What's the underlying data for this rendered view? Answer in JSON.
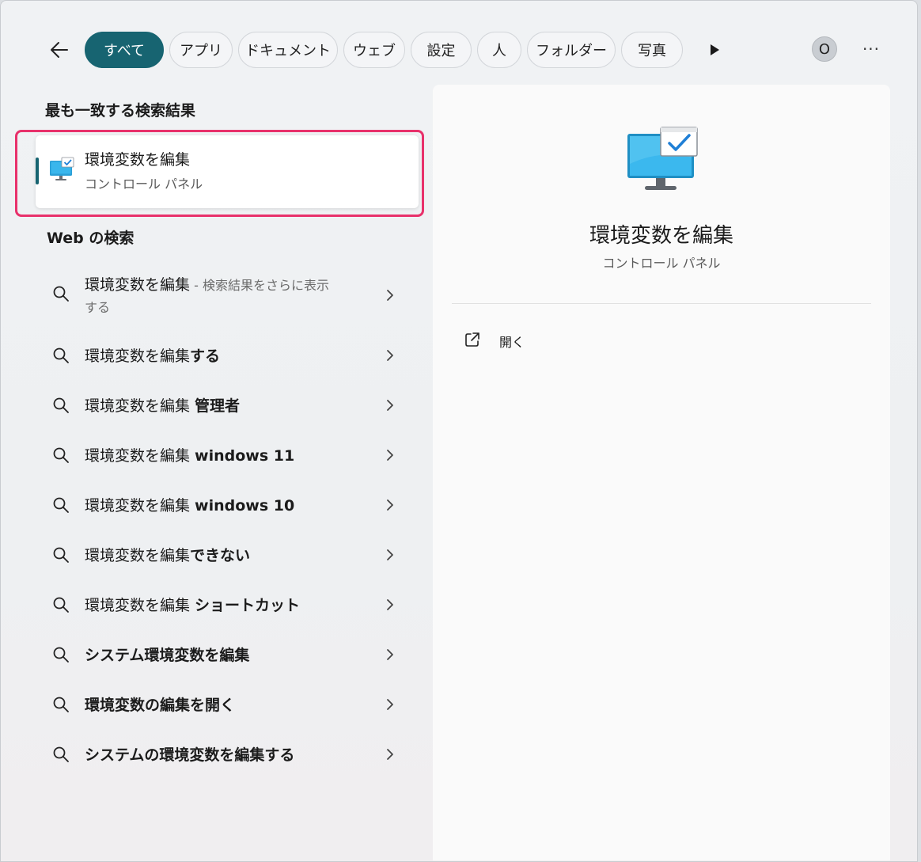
{
  "filters": {
    "back_icon": "arrow-left-icon",
    "tabs": [
      {
        "label": "すべて",
        "active": true
      },
      {
        "label": "アプリ"
      },
      {
        "label": "ドキュメント"
      },
      {
        "label": "ウェブ"
      },
      {
        "label": "設定"
      },
      {
        "label": "人"
      },
      {
        "label": "フォルダー"
      },
      {
        "label": "写真"
      }
    ],
    "more_tabs_icon": "play-icon",
    "avatar_letter": "O",
    "more_label": "···"
  },
  "best_match": {
    "section_title": "最も一致する検索結果",
    "title": "環境変数を編集",
    "subtitle": "コントロール パネル",
    "icon": "monitor-check-icon"
  },
  "web": {
    "section_title": "Web の検索",
    "items": [
      {
        "text": "環境変数を編集",
        "suffix": " - 検索結果をさらに表示",
        "line2": "する"
      },
      {
        "text": "環境変数を編集",
        "bold": "する"
      },
      {
        "text": "環境変数を編集 ",
        "bold": "管理者"
      },
      {
        "text": "環境変数を編集 ",
        "bold": "windows 11"
      },
      {
        "text": "環境変数を編集 ",
        "bold": "windows 10"
      },
      {
        "text": "環境変数を編集",
        "bold": "できない"
      },
      {
        "text": "環境変数を編集 ",
        "bold": "ショートカット"
      },
      {
        "text": "",
        "bold": "システム環境変数を編集"
      },
      {
        "text": "",
        "bold": "環境変数の編集を開く"
      },
      {
        "text": "",
        "bold": "システムの環境変数を編集する"
      }
    ]
  },
  "preview": {
    "title": "環境変数を編集",
    "subtitle": "コントロール パネル",
    "open_label": "開く"
  },
  "colors": {
    "accent": "#176471",
    "highlight": "#e8316b"
  }
}
